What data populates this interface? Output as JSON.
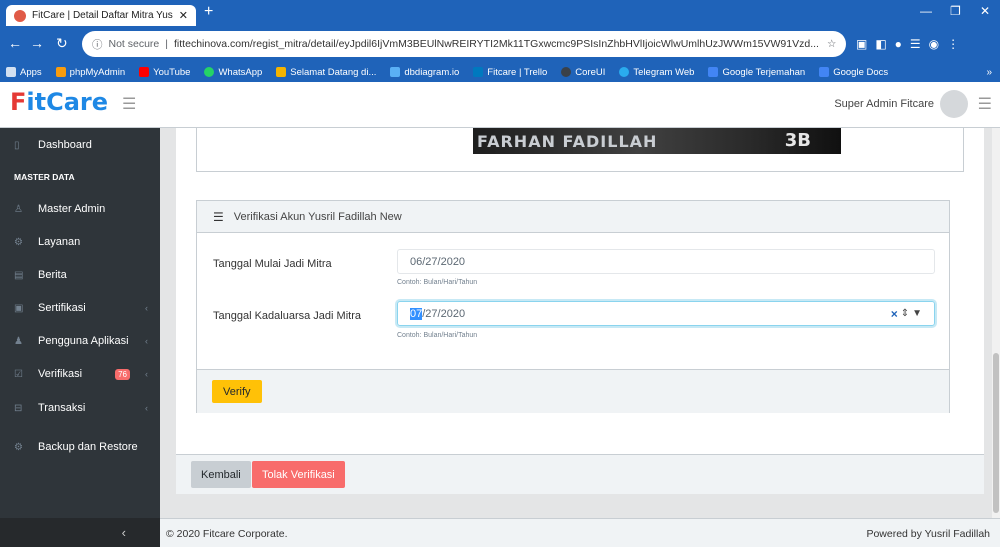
{
  "browser": {
    "tab_title": "FitCare | Detail Daftar Mitra Yusri",
    "tab_close": "✕",
    "new_tab": "+",
    "not_secure": "Not secure",
    "url": "fittechinova.com/regist_mitra/detail/eyJpdil6IjVmM3BEUlNwREIRYTI2Mk11TGxwcmc9PSIsInZhbHVlIjoicWlwUmlhUzJWWm15VW91Vzd...",
    "bookmarks": [
      "Apps",
      "phpMyAdmin",
      "YouTube",
      "WhatsApp",
      "Selamat Datang di...",
      "dbdiagram.io",
      "Fitcare | Trello",
      "CoreUI",
      "Telegram Web",
      "Google Terjemahan",
      "Google Docs"
    ],
    "bookmark_more": "»"
  },
  "header": {
    "logo_f": "F",
    "logo_rest": "itCare",
    "user_name": "Super Admin Fitcare"
  },
  "sidebar": {
    "dashboard": "Dashboard",
    "section_title": "MASTER DATA",
    "master_admin": "Master Admin",
    "layanan": "Layanan",
    "berita": "Berita",
    "sertifikasi": "Sertifikasi",
    "pengguna_aplikasi": "Pengguna Aplikasi",
    "verifikasi": "Verifikasi",
    "verifikasi_badge": "76",
    "transaksi": "Transaksi",
    "backup": "Backup dan Restore",
    "collapse": "‹"
  },
  "banner": {
    "name": "FARHAN FADILLAH",
    "number": "3B"
  },
  "verification": {
    "header": "Verifikasi Akun Yusril Fadillah New",
    "start_label": "Tanggal Mulai Jadi Mitra",
    "start_value": "06/27/2020",
    "start_help": "Contoh: Bulan/Hari/Tahun",
    "expiry_label": "Tanggal Kadaluarsa Jadi Mitra",
    "expiry_segment": "07",
    "expiry_rest": "/27/2020",
    "expiry_help": "Contoh: Bulan/Hari/Tahun",
    "verify_button": "Verify"
  },
  "actions": {
    "back": "Kembali",
    "reject": "Tolak Verifikasi"
  },
  "footer": {
    "copyright": "© 2020 Fitcare Corporate.",
    "powered": "Powered by Yusril Fadillah"
  },
  "colors": {
    "browser_chrome": "#1f63b9",
    "sidebar_bg": "#2f353a",
    "verify_button": "#ffc107",
    "reject_button": "#f86c6b",
    "back_button": "#c8ced3",
    "logo_red": "#e53935",
    "logo_blue": "#1e88e5",
    "badge": "#f86c6b"
  }
}
